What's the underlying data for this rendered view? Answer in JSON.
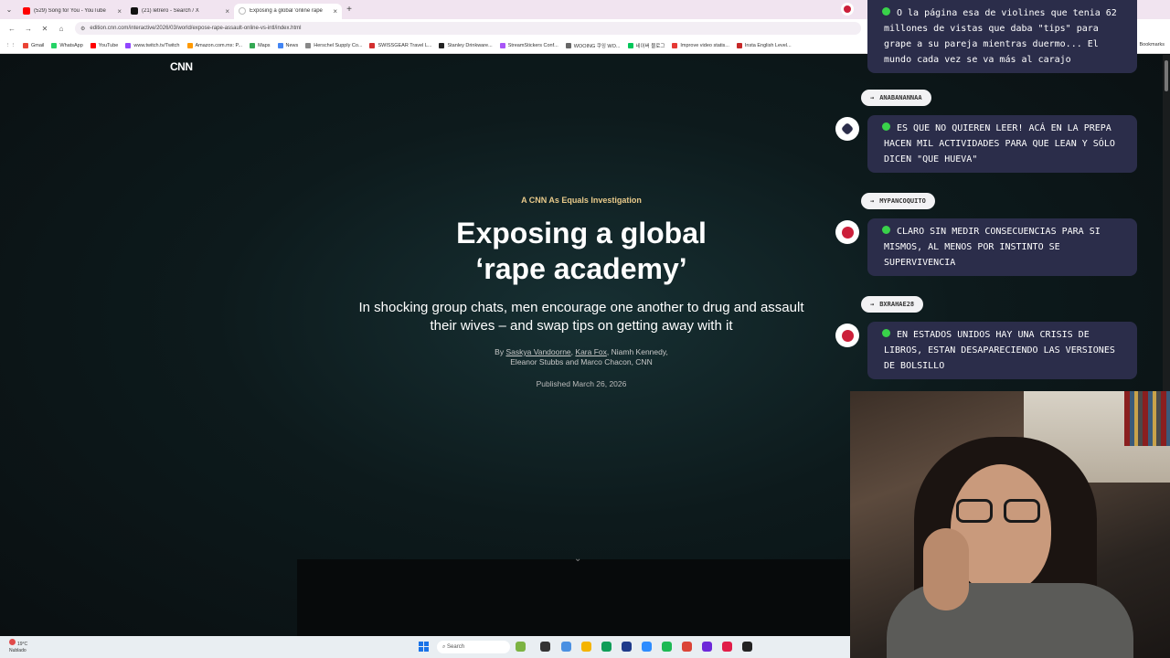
{
  "browser": {
    "tabs": [
      {
        "title": "(529) Song for You - YouTube",
        "icon": "youtube-icon",
        "active": false
      },
      {
        "title": "(21) letrero - Search / X",
        "icon": "x-icon",
        "active": false
      },
      {
        "title": "Exposing a global 'online rape",
        "icon": "cnn-icon",
        "active": true
      }
    ],
    "new_tab": "+",
    "url": "edition.cnn.com/interactive/2026/03/world/expose-rape-assault-online-vs-intl/index.html",
    "bookmarks": [
      "Gmail",
      "WhatsApp",
      "YouTube",
      "www.twitch.tv/Twitch",
      "Amazon.com.mx: P...",
      "Maps",
      "News",
      "Herschel Supply Co...",
      "SWISSGEAR Travel L...",
      "Stanley Drinkware...",
      "StreamStickers Conf...",
      "WOOING 쿠잉 WO...",
      "네이버 블로그",
      "Improve video statis...",
      "Insta English Level..."
    ],
    "bookmarks_right": "Bookmarks"
  },
  "article": {
    "logo": "CNN",
    "kicker": "A CNN As Equals Investigation",
    "headline_line1": "Exposing a global",
    "headline_line2": "‘rape academy’",
    "dek": "In shocking group chats, men encourage one another to drug and assault their wives – and swap tips on getting away with it",
    "byline_prefix": "By",
    "author1": "Saskya Vandoorne",
    "author2": "Kara Fox",
    "byline_rest1": ", Niamh Kennedy,",
    "byline_rest2": "Eleanor Stubbs and Marco Chacon, CNN",
    "published": "Published March 26, 2026"
  },
  "chat": {
    "messages": [
      {
        "text": "O la página esa de violines que tenia 62 millones de vistas que daba \"tips\" para grape a su pareja mientras duermo... El mundo cada vez se va más al carajo"
      },
      {
        "user": "ANABANANNAA",
        "text": "ES QUE NO QUIEREN LEER! ACÁ EN LA PREPA HACEN MIL ACTIVIDADES PARA QUE LEAN Y SÓLO DICEN \"QUE HUEVA\""
      },
      {
        "user": "MYPANCOQUITO",
        "text": "CLARO SIN MEDIR CONSECUENCIAS PARA SI MISMOS, AL MENOS POR INSTINTO SE SUPERVIVENCIA"
      },
      {
        "user": "BXRAHAE28",
        "text": "EN ESTADOS UNIDOS HAY UNA CRISIS DE LIBROS, ESTAN DESAPARECIENDO LAS VERSIONES DE BOLSILLO"
      }
    ]
  },
  "taskbar": {
    "weather_temp": "19°C",
    "weather_desc": "Nublado",
    "search_placeholder": "Search"
  },
  "colors": {
    "accent_kicker": "#e8c98a",
    "chat_bubble": "#2b2d4a",
    "chat_dot": "#39d24a",
    "avatar_red": "#cc1f3a"
  }
}
